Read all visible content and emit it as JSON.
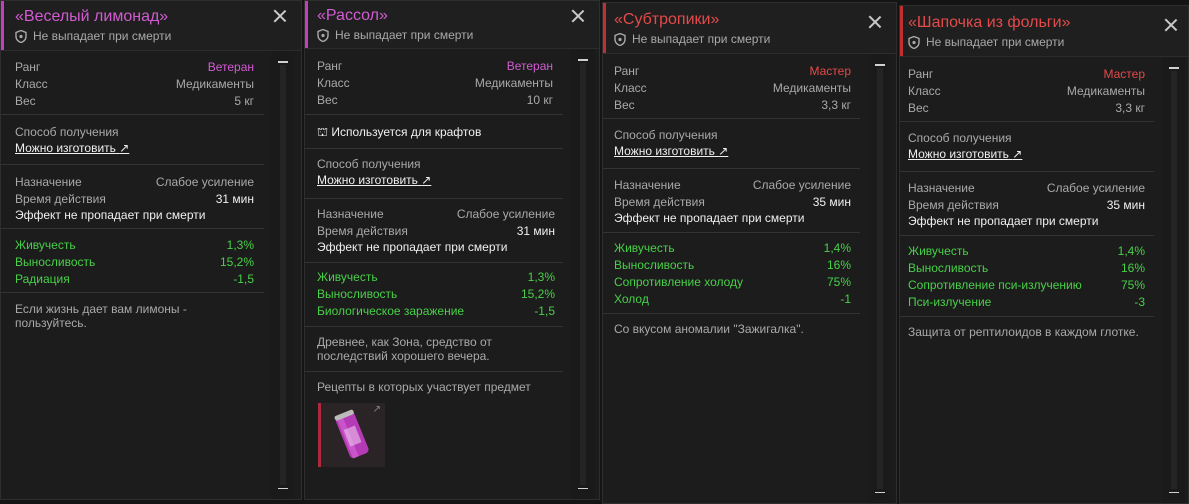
{
  "colors": {
    "veteran": "#d15cd1",
    "master": "#e34a4a",
    "positive": "#48d048",
    "accent_veteran": "#c040c0",
    "accent_master": "#c03030"
  },
  "common": {
    "no_drop": "Не выпадает при смерти",
    "rank": "Ранг",
    "class": "Класс",
    "weight": "Вес",
    "obtain": "Способ получения",
    "craftable": "Можно изготовить",
    "purpose": "Назначение",
    "duration": "Время действия",
    "persist": "Эффект не пропадает при смерти"
  },
  "cards": [
    {
      "title": "«Веселый лимонад»",
      "rank": "Ветеран",
      "cls": "Медикаменты",
      "weight": "5 кг",
      "purpose": "Слабое усиление",
      "duration": "31 мин",
      "stats": [
        {
          "n": "Живучесть",
          "v": "1,3%"
        },
        {
          "n": "Выносливость",
          "v": "15,2%"
        },
        {
          "n": "Радиация",
          "v": "-1,5"
        }
      ],
      "desc1": "Если жизнь дает вам лимоны -",
      "desc2": "пользуйтесь."
    },
    {
      "title": "«Рассол»",
      "rank": "Ветеран",
      "cls": "Медикаменты",
      "weight": "10 кг",
      "craft_use": "Используется для крафтов",
      "purpose": "Слабое усиление",
      "duration": "31 мин",
      "stats": [
        {
          "n": "Живучесть",
          "v": "1,3%"
        },
        {
          "n": "Выносливость",
          "v": "15,2%"
        },
        {
          "n": "Биологическое заражение",
          "v": "-1,5"
        }
      ],
      "desc1": "Древнее, как Зона, средство от",
      "desc2": "последствий хорошего вечера.",
      "recipes": "Рецепты в которых участвует предмет"
    },
    {
      "title": "«Субтропики»",
      "rank": "Мастер",
      "cls": "Медикаменты",
      "weight": "3,3 кг",
      "purpose": "Слабое усиление",
      "duration": "35 мин",
      "stats": [
        {
          "n": "Живучесть",
          "v": "1,4%"
        },
        {
          "n": "Выносливость",
          "v": "16%"
        },
        {
          "n": "Сопротивление холоду",
          "v": "75%"
        },
        {
          "n": "Холод",
          "v": "-1"
        }
      ],
      "desc1": "Со вкусом аномалии \"Зажигалка\"."
    },
    {
      "title": "«Шапочка из фольги»",
      "rank": "Мастер",
      "cls": "Медикаменты",
      "weight": "3,3 кг",
      "purpose": "Слабое усиление",
      "duration": "35 мин",
      "stats": [
        {
          "n": "Живучесть",
          "v": "1,4%"
        },
        {
          "n": "Выносливость",
          "v": "16%"
        },
        {
          "n": "Сопротивление пси-излучению",
          "v": "75%"
        },
        {
          "n": "Пси-излучение",
          "v": "-3"
        }
      ],
      "desc1": "Защита от рептилоидов в каждом глотке."
    }
  ]
}
